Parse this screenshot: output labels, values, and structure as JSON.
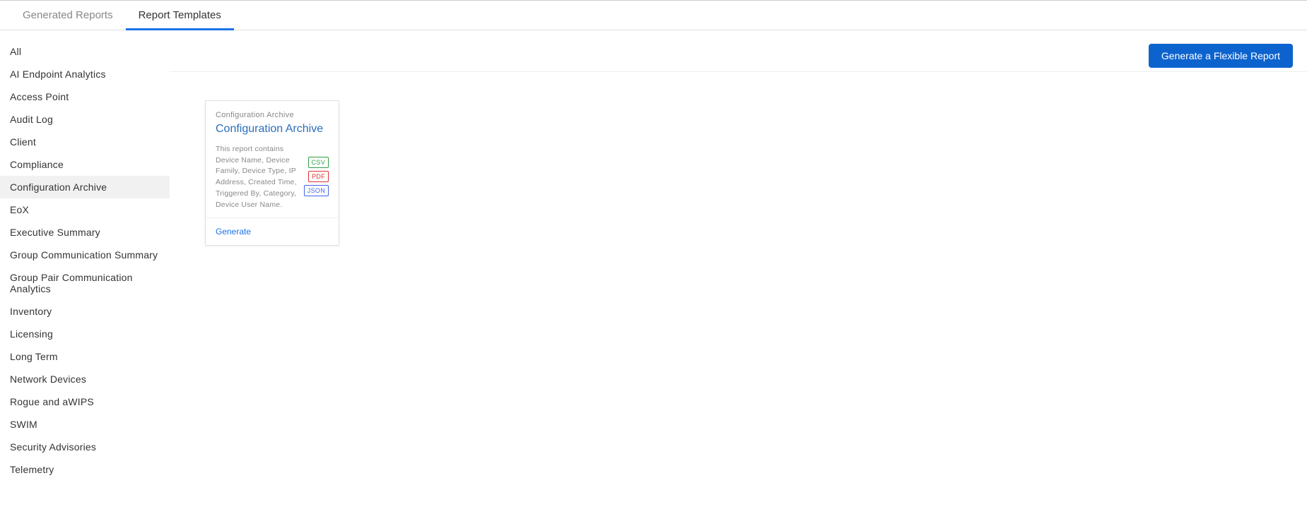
{
  "tabs": [
    {
      "label": "Generated Reports",
      "active": false
    },
    {
      "label": "Report Templates",
      "active": true
    }
  ],
  "actions": {
    "flexible_report_label": "Generate a Flexible Report"
  },
  "sidebar": {
    "items": [
      {
        "label": "All",
        "selected": false
      },
      {
        "label": "AI Endpoint Analytics",
        "selected": false
      },
      {
        "label": "Access Point",
        "selected": false
      },
      {
        "label": "Audit Log",
        "selected": false
      },
      {
        "label": "Client",
        "selected": false
      },
      {
        "label": "Compliance",
        "selected": false
      },
      {
        "label": "Configuration Archive",
        "selected": true
      },
      {
        "label": "EoX",
        "selected": false
      },
      {
        "label": "Executive Summary",
        "selected": false
      },
      {
        "label": "Group Communication Summary",
        "selected": false
      },
      {
        "label": "Group Pair Communication Analytics",
        "selected": false
      },
      {
        "label": "Inventory",
        "selected": false
      },
      {
        "label": "Licensing",
        "selected": false
      },
      {
        "label": "Long Term",
        "selected": false
      },
      {
        "label": "Network Devices",
        "selected": false
      },
      {
        "label": "Rogue and aWIPS",
        "selected": false
      },
      {
        "label": "SWIM",
        "selected": false
      },
      {
        "label": "Security Advisories",
        "selected": false
      },
      {
        "label": "Telemetry",
        "selected": false
      }
    ]
  },
  "templates": [
    {
      "category": "Configuration Archive",
      "title": "Configuration Archive",
      "description": "This report contains Device Name, Device Family, Device Type, IP Address, Created Time, Triggered By, Category, Device User Name.",
      "formats": [
        "CSV",
        "PDF",
        "JSON"
      ],
      "generate_label": "Generate"
    }
  ]
}
